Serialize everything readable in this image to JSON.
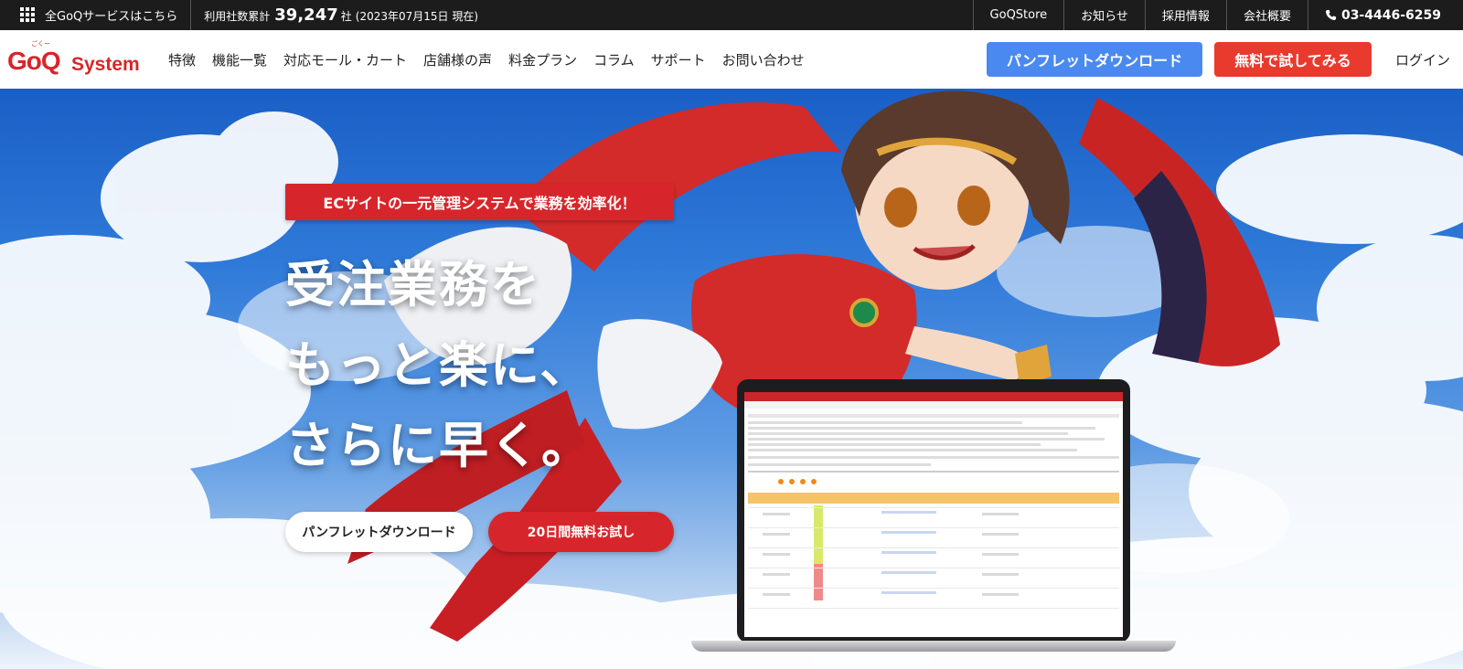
{
  "topbar": {
    "services_label": "全GoQサービスはこちら",
    "count_prefix": "利用社数累計",
    "count_value": "39,247",
    "count_unit": "社",
    "count_date": "(2023年07月15日 現在)",
    "links": [
      "GoQStore",
      "お知らせ",
      "採用情報",
      "会社概要"
    ],
    "phone": "03-4446-6259"
  },
  "nav": {
    "logo_main": "GoQ",
    "logo_sub": "System",
    "logo_kana": "ごくー",
    "links": [
      "特徴",
      "機能一覧",
      "対応モール・カート",
      "店舗様の声",
      "料金プラン",
      "コラム",
      "サポート",
      "お問い合わせ"
    ],
    "pamphlet_button": "パンフレットダウンロード",
    "trial_button": "無料で試してみる",
    "login": "ログイン"
  },
  "hero": {
    "tagline": "ECサイトの一元管理システムで業務を効率化！",
    "headline_1": "受注業務を",
    "headline_2": "もっと楽に、",
    "headline_3": "さらに早く。",
    "button_pamphlet": "パンフレットダウンロード",
    "button_trial": "20日間無料お試し"
  },
  "colors": {
    "brand_red": "#d7262b",
    "accent_blue": "#4a8af0",
    "cta_red": "#e93a2e",
    "topbar_bg": "#1c1c1c"
  }
}
